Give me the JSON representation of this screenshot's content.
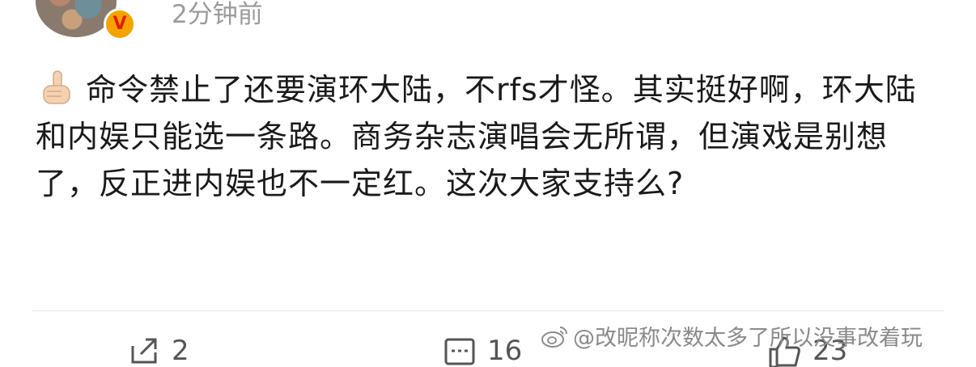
{
  "post": {
    "time": "2分钟前",
    "text": "命令禁止了还要演环大陆，不rfs才怪。其实挺好啊，环大陆和内娱只能选一条路。商务杂志演唱会无所谓，但演戏是别想了，反正进内娱也不一定红。这次大家支持么?"
  },
  "actions": {
    "repost_count": "2",
    "comment_count": "16",
    "like_count": "23"
  },
  "watermark": {
    "text": "@改昵称次数太多了所以没事改着玩"
  },
  "colors": {
    "verified_badge": "#f5a300",
    "time_text": "#9b9b9b",
    "body_text": "#1a1a1a"
  }
}
